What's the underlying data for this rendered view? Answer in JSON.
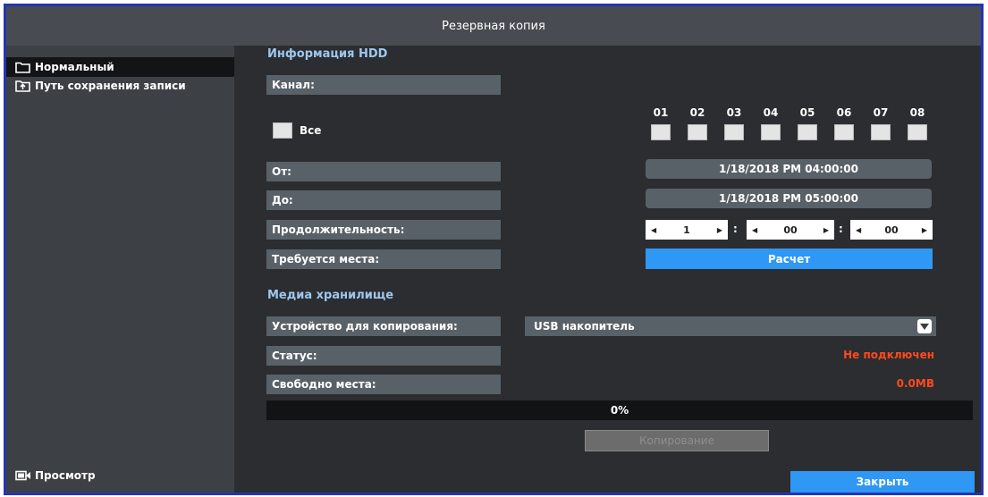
{
  "window": {
    "title": "Резервная копия"
  },
  "sidebar": {
    "items": [
      {
        "label": "Нормальный",
        "icon": "folder-icon"
      },
      {
        "label": "Путь сохранения записи",
        "icon": "export-folder-icon"
      }
    ],
    "preview": {
      "label": "Просмотр",
      "icon": "video-camera-icon"
    }
  },
  "hdd": {
    "title": "Информация HDD",
    "channel_label": "Канал:",
    "all_label": "Все",
    "all_checked": false,
    "channels": [
      {
        "num": "01",
        "checked": false
      },
      {
        "num": "02",
        "checked": false
      },
      {
        "num": "03",
        "checked": false
      },
      {
        "num": "04",
        "checked": false
      },
      {
        "num": "05",
        "checked": false
      },
      {
        "num": "06",
        "checked": false
      },
      {
        "num": "07",
        "checked": false
      },
      {
        "num": "08",
        "checked": false
      }
    ],
    "from_label": "От:",
    "from_value": "1/18/2018 PM 04:00:00",
    "to_label": "До:",
    "to_value": "1/18/2018 PM 05:00:00",
    "duration_label": "Продолжительность:",
    "duration": {
      "hours": "1",
      "minutes": "00",
      "seconds": "00",
      "separator": ":"
    },
    "required_label": "Требуется места:",
    "calc_button": "Расчет"
  },
  "media": {
    "title": "Медиа хранилище",
    "device_label": "Устройство для копирования:",
    "device_value": "USB накопитель",
    "status_label": "Статус:",
    "status_value": "Не подключен",
    "free_label": "Свободно места:",
    "free_value": "0.0MB",
    "progress_percent": 0,
    "progress_text": "0%",
    "copy_button": "Копирование",
    "copy_enabled": false
  },
  "footer": {
    "close_button": "Закрыть"
  },
  "colors": {
    "accent": "#2f97f4",
    "border": "#2534b3",
    "section_title": "#9ec7ee",
    "error": "#ff4a1c"
  }
}
